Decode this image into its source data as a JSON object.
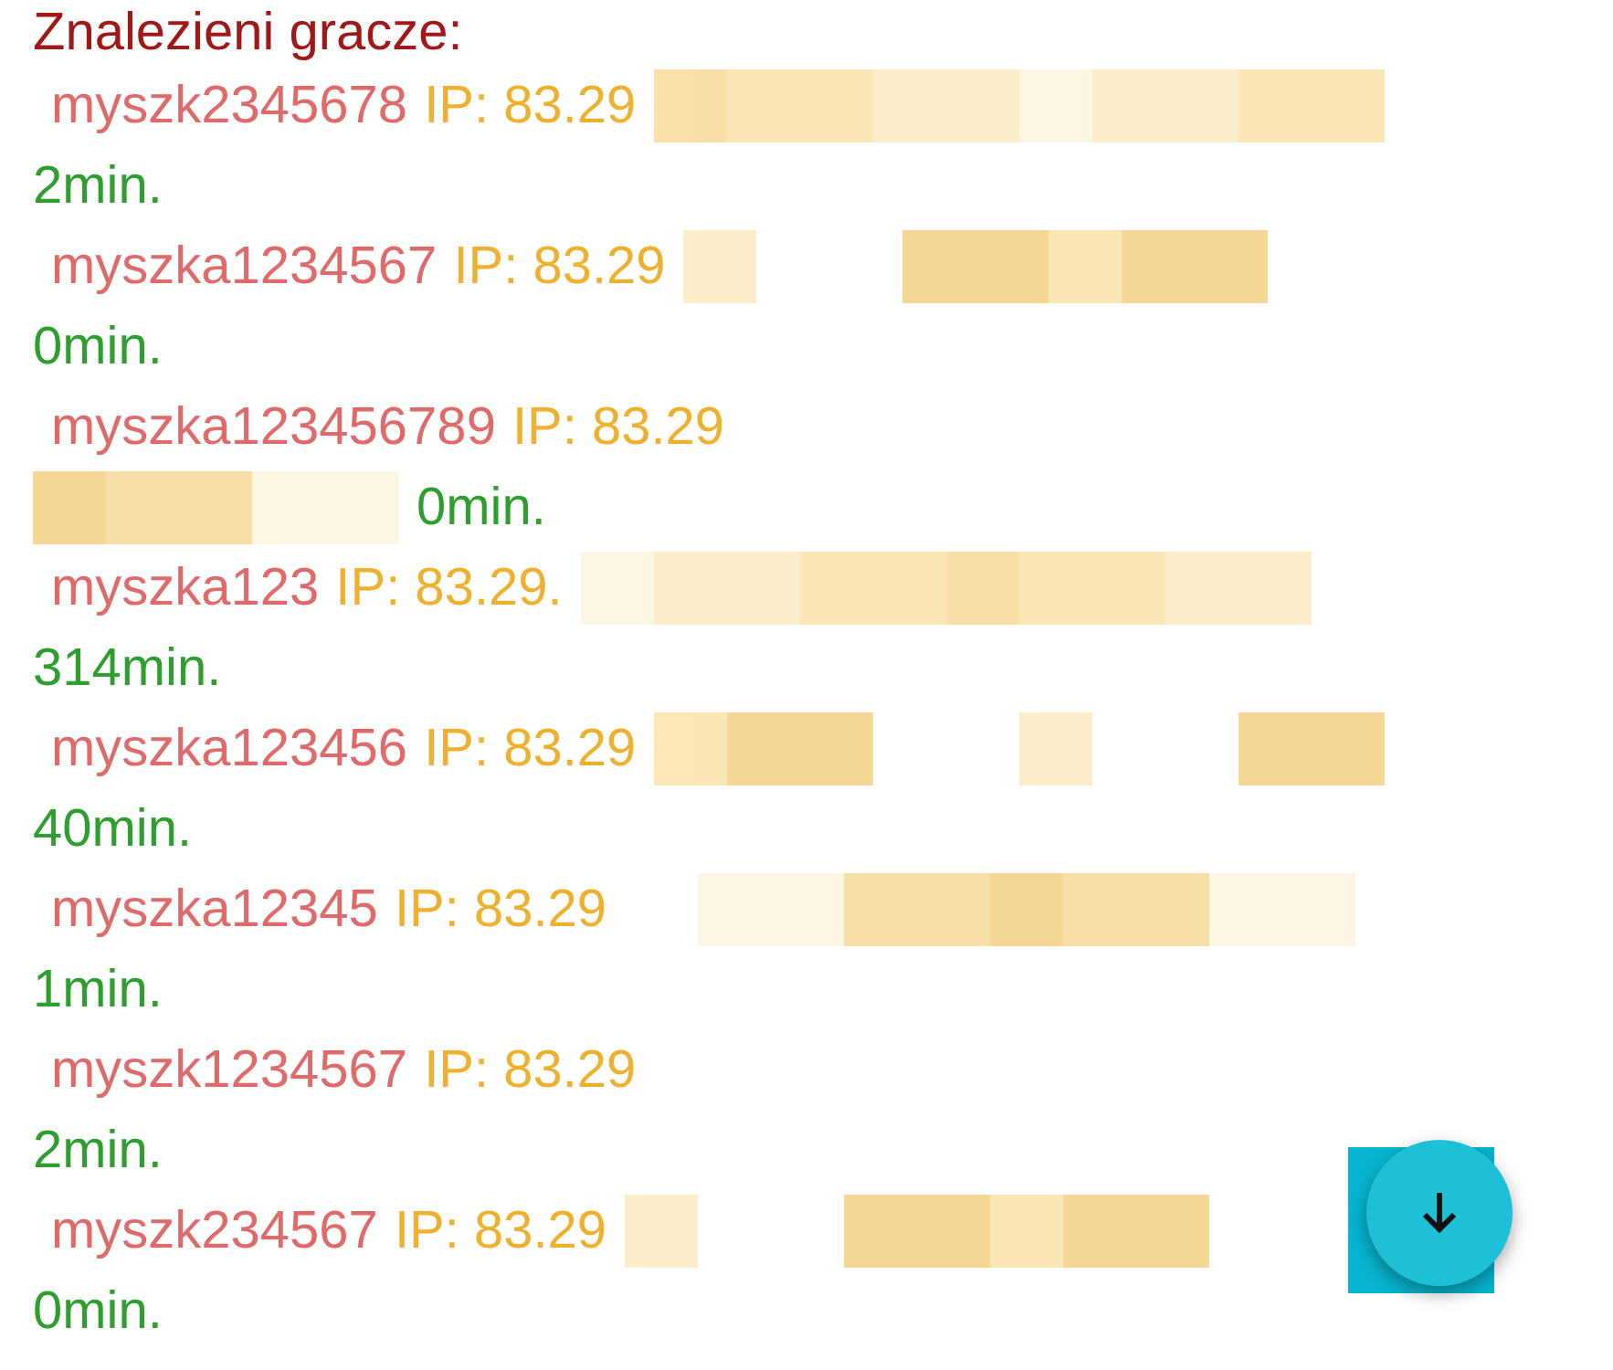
{
  "heading": "Znalezieni gracze:",
  "players": [
    {
      "name": "myszk2345678",
      "ip": "IP: 83.29",
      "time": "2min.",
      "kind": "blurred"
    },
    {
      "name": "myszka1234567",
      "ip": "IP: 83.29",
      "time": "0min.",
      "kind": "blurred"
    },
    {
      "name": "myszka123456789",
      "ip": "IP: 83.29",
      "time": "0min.",
      "kind": "wrapped"
    },
    {
      "name": "myszka123",
      "ip": "IP: 83.29.",
      "time": "314min.",
      "kind": "blurred"
    },
    {
      "name": "myszka123456",
      "ip": "IP: 83.29",
      "time": "40min.",
      "kind": "blurred"
    },
    {
      "name": "myszka12345",
      "ip": "IP: 83.29",
      "time": "1min.",
      "kind": "blurred"
    },
    {
      "name": "myszk1234567",
      "ip": "IP: 83.29",
      "time": "2min.",
      "kind": "plain"
    },
    {
      "name": "myszk234567",
      "ip": "IP: 83.29",
      "time": "0min.",
      "kind": "blurred"
    }
  ]
}
